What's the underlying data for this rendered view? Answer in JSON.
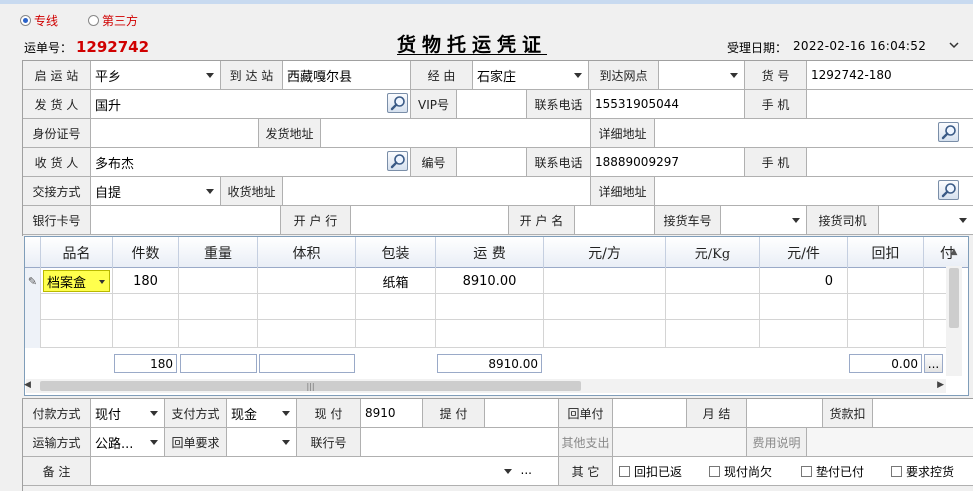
{
  "mode": {
    "option1": "专线",
    "option2": "第三方"
  },
  "header": {
    "waybill_label": "运单号：",
    "waybill_no": "1292742",
    "title": "货物托运凭证",
    "accept_date_label": "受理日期：",
    "accept_date": "2022-02-16 16:04:52"
  },
  "form": {
    "start_station_label": "启 运 站",
    "start_station": "平乡",
    "dest_station_label": "到 达 站",
    "dest_station": "西藏嘎尔县",
    "via_label": "经   由",
    "via": "石家庄",
    "dest_outlet_label": "到达网点",
    "dest_outlet": "",
    "cargo_no_label": "货   号",
    "cargo_no": "1292742-180",
    "shipper_label": "发 货 人",
    "shipper": "国升",
    "vip_label": "VIP号",
    "vip": "",
    "phone1_label": "联系电话",
    "phone1": "15531905044",
    "mobile1_label": "手   机",
    "mobile1": "",
    "id_label": "身份证号",
    "id_no": "",
    "ship_addr_label": "发货地址",
    "ship_addr": "",
    "detail_addr1_label": "详细地址",
    "detail_addr1": "",
    "consignee_label": "收 货 人",
    "consignee": "多布杰",
    "code_label": "编号",
    "code": "",
    "phone2_label": "联系电话",
    "phone2": "18889009297",
    "mobile2_label": "手   机",
    "mobile2": "",
    "handover_label": "交接方式",
    "handover": "自提",
    "recv_addr_label": "收货地址",
    "recv_addr": "",
    "detail_addr2_label": "详细地址",
    "detail_addr2": "",
    "bank_card_label": "银行卡号",
    "bank_card": "",
    "bank_label": "开 户 行",
    "bank": "",
    "account_name_label": "开 户 名",
    "account_name": "",
    "pickup_car_label": "接货车号",
    "pickup_car": "",
    "pickup_driver_label": "接货司机",
    "pickup_driver": ""
  },
  "table": {
    "columns": [
      "品名",
      "件数",
      "重量",
      "体积",
      "包装",
      "运  费",
      "元/方",
      "元/Kg",
      "元/件",
      "回扣",
      "付"
    ],
    "rows": [
      [
        "档案盒",
        "180",
        "",
        "",
        "纸箱",
        "8910.00",
        "",
        "",
        "0",
        "",
        ""
      ]
    ],
    "totals": {
      "count": "180",
      "freight": "8910.00",
      "rebate": "0.00",
      "more": "..."
    }
  },
  "bottom": {
    "pay_method_label": "付款方式",
    "pay_method": "现付",
    "pay_type_label": "支付方式",
    "pay_type": "现金",
    "cash_pay_label": "现   付",
    "cash_pay": "8910",
    "pickup_pay_label": "提   付",
    "pickup_pay": "",
    "return_pay_label": "回单付",
    "return_pay": "",
    "monthly_label": "月   结",
    "monthly": "",
    "deduct_label": "货款扣",
    "deduct": "",
    "transport_label": "运输方式",
    "transport": "公路...",
    "receipt_req_label": "回单要求",
    "receipt_req": "",
    "bank_no_label": "联行号",
    "bank_no": "",
    "other_exp_label": "其他支出",
    "other_exp": "",
    "fee_desc_label": "费用说明",
    "fee_desc": "",
    "remark_label": "备   注",
    "remark": "",
    "remark_more": "...",
    "other_label": "其   它",
    "chk1": "回扣已返",
    "chk2": "现付尚欠",
    "chk3": "垫付已付",
    "chk4": "要求控货"
  }
}
